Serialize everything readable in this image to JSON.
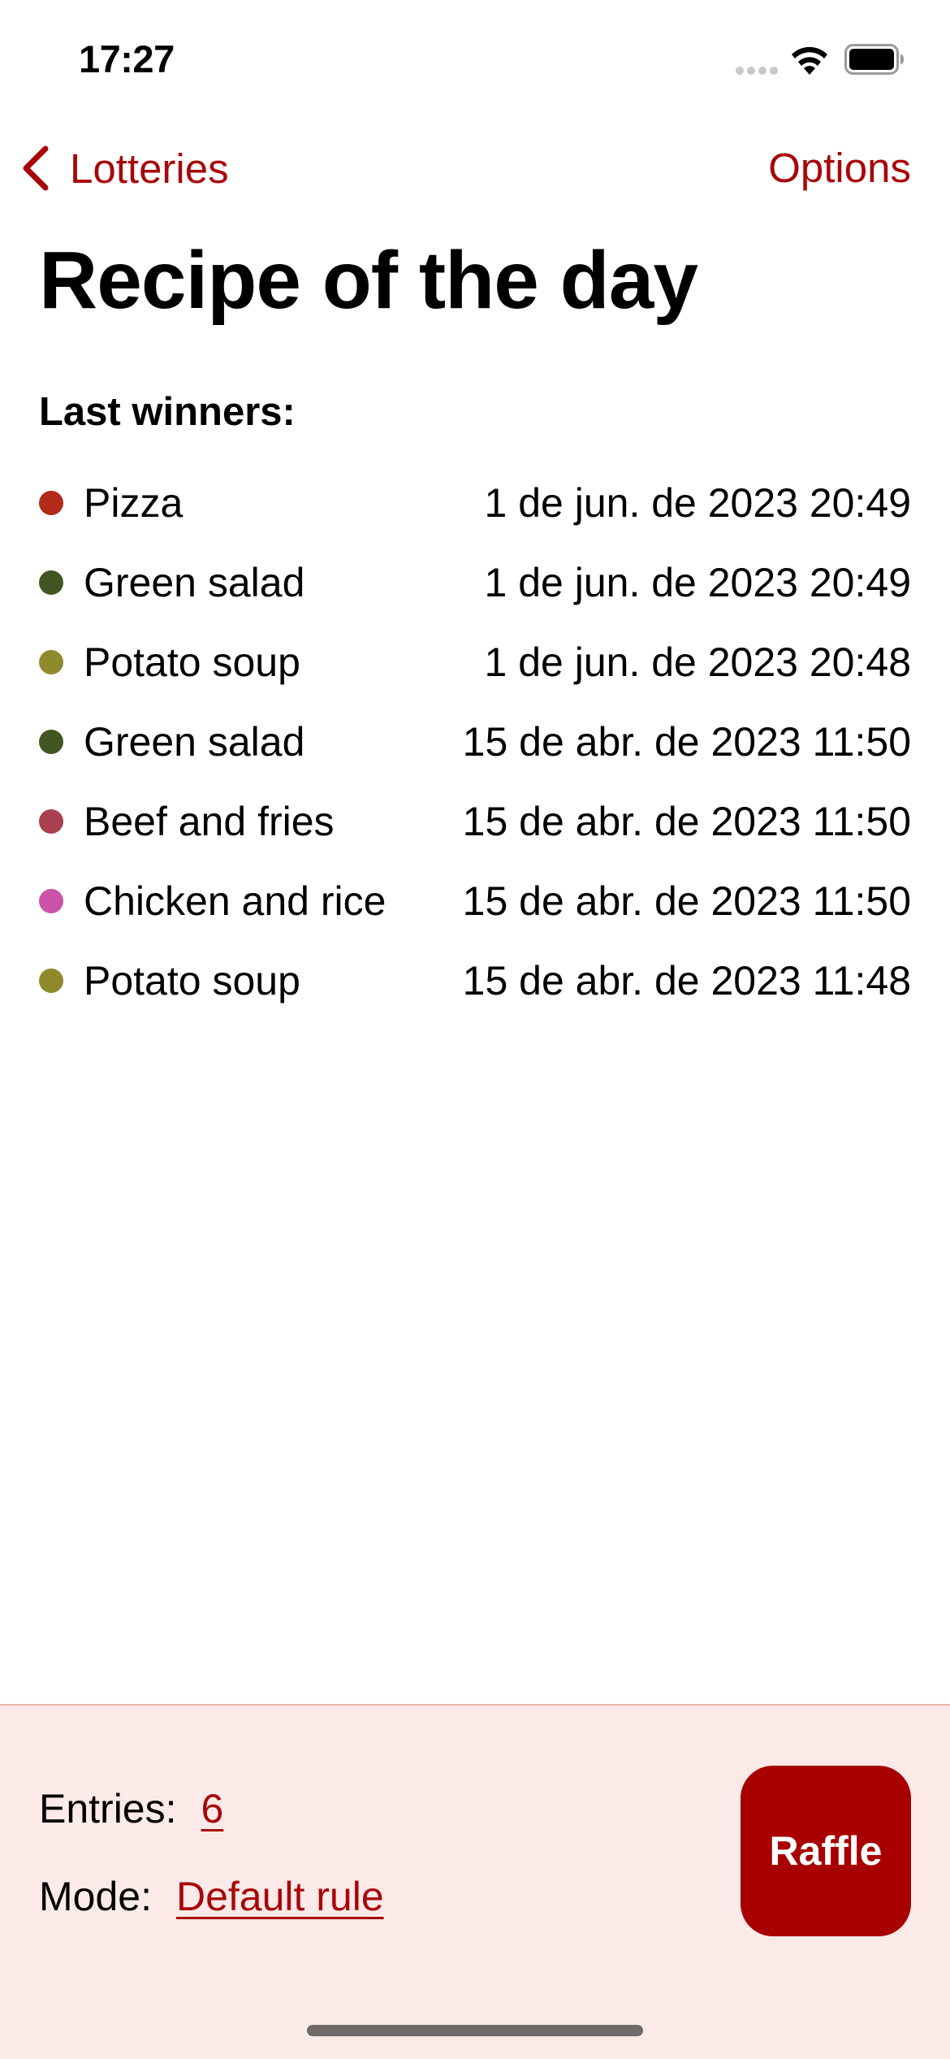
{
  "status_bar": {
    "time": "17:27"
  },
  "nav": {
    "back_label": "Lotteries",
    "options_label": "Options"
  },
  "title": "Recipe of the day",
  "winners": {
    "heading": "Last winners:",
    "items": [
      {
        "name": "Pizza",
        "date": "1 de jun. de 2023 20:49",
        "color": "#B12A1A"
      },
      {
        "name": "Green salad",
        "date": "1 de jun. de 2023 20:49",
        "color": "#425623"
      },
      {
        "name": "Potato soup",
        "date": "1 de jun. de 2023 20:48",
        "color": "#8E8A2C"
      },
      {
        "name": "Green salad",
        "date": "15 de abr. de 2023 11:50",
        "color": "#425623"
      },
      {
        "name": "Beef and fries",
        "date": "15 de abr. de 2023 11:50",
        "color": "#A8404F"
      },
      {
        "name": "Chicken and rice",
        "date": "15 de abr. de 2023 11:50",
        "color": "#CC52A8"
      },
      {
        "name": "Potato soup",
        "date": "15 de abr. de 2023 11:48",
        "color": "#8E8A2C"
      }
    ]
  },
  "footer": {
    "entries_label": "Entries:",
    "entries_value": "6",
    "mode_label": "Mode:",
    "mode_value": "Default rule",
    "raffle_label": "Raffle"
  },
  "colors": {
    "accent": "#A8060A",
    "button_bg": "#A80000",
    "panel_bg": "#FBEAE7"
  },
  "icons": {
    "back": "chevron-left-icon",
    "signal": "cellular-signal-icon",
    "wifi": "wifi-icon",
    "battery": "battery-icon"
  }
}
